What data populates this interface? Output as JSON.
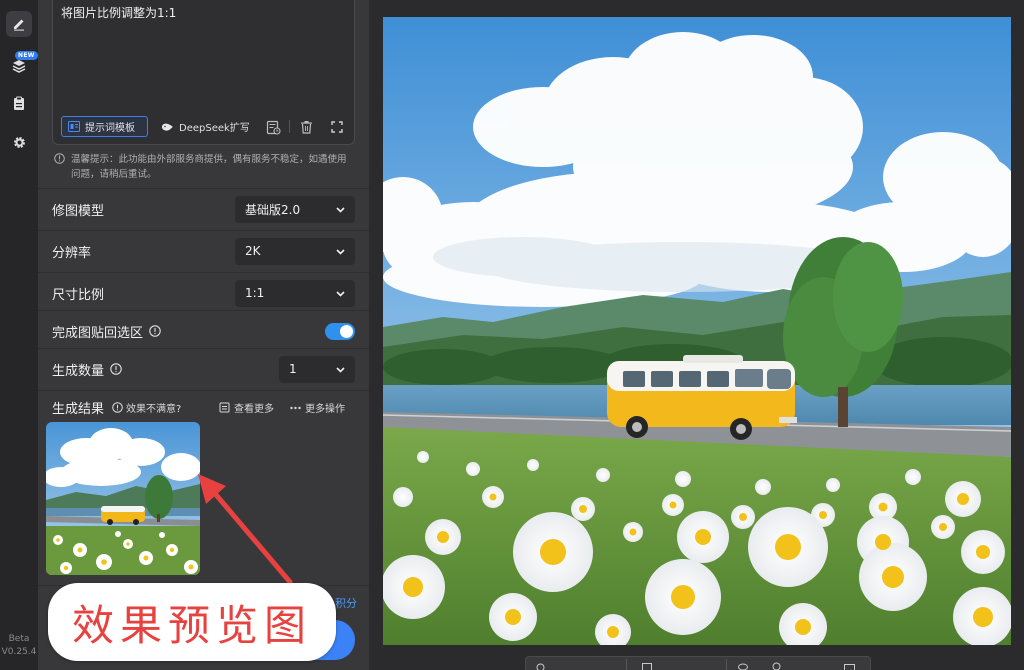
{
  "rail": {
    "new_badge": "NEW",
    "version_line1": "Beta",
    "version_line2": "V0.25.4"
  },
  "prompt": {
    "text": "将图片比例调整为1:1",
    "template_button": "提示词模板",
    "deepseek_button": "DeepSeek扩写"
  },
  "notice": "温馨提示：此功能由外部服务商提供，偶有服务不稳定，如遇使用问题，请稍后重试。",
  "settings": {
    "model_label": "修图模型",
    "model_value": "基础版2.0",
    "resolution_label": "分辨率",
    "resolution_value": "2K",
    "ratio_label": "尺寸比例",
    "ratio_value": "1:1",
    "paste_label": "完成图贴回选区",
    "paste_enabled": true,
    "count_label": "生成数量",
    "count_value": "1"
  },
  "result": {
    "title": "生成结果",
    "unsatisfied": "效果不满意?",
    "view_more": "查看更多",
    "more_ops": "更多操作"
  },
  "credit_text": "积分",
  "annotation": "效果预览图",
  "colors": {
    "accent": "#3b82f6",
    "annotation_red": "#e7423f",
    "panel_bg": "#38383b"
  }
}
